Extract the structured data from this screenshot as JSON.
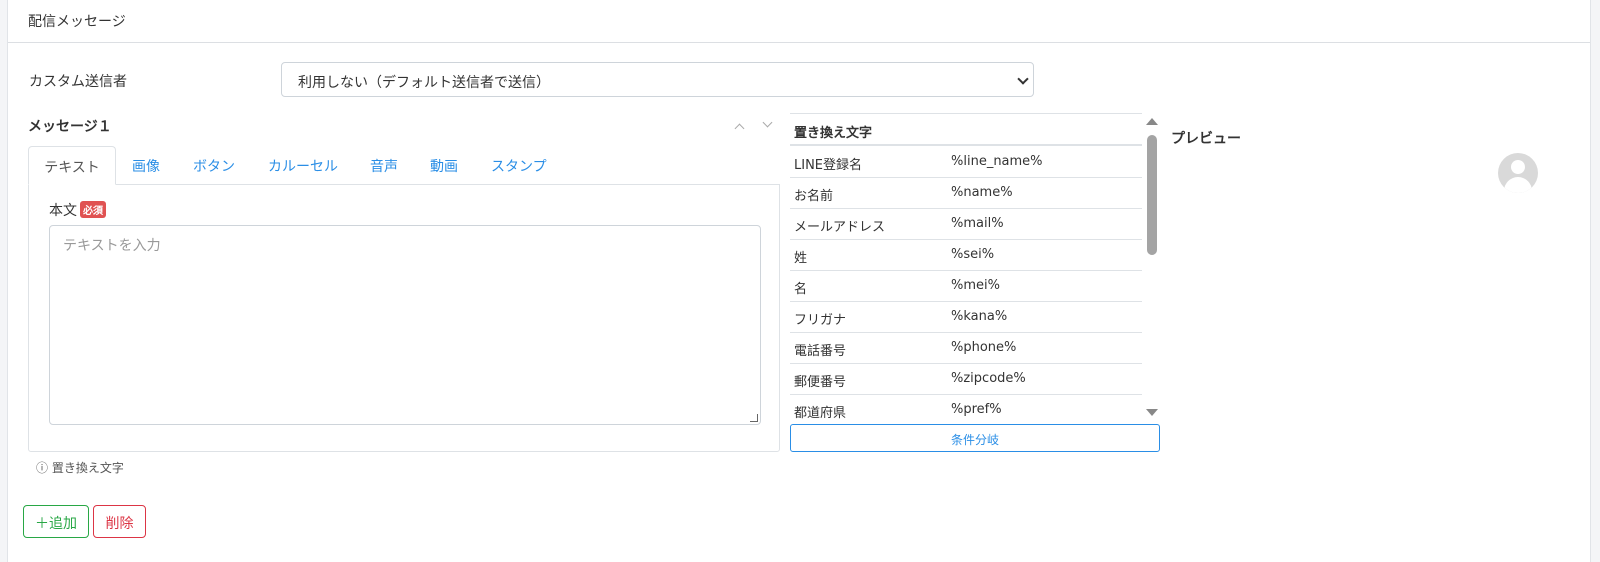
{
  "card": {
    "title": "配信メッセージ"
  },
  "sender": {
    "label": "カスタム送信者",
    "selected": "利用しない（デフォルト送信者で送信）"
  },
  "message": {
    "title": "メッセージ１",
    "tabs": [
      {
        "label": "テキスト",
        "active": true
      },
      {
        "label": "画像"
      },
      {
        "label": "ボタン"
      },
      {
        "label": "カルーセル"
      },
      {
        "label": "音声"
      },
      {
        "label": "動画"
      },
      {
        "label": "スタンプ"
      }
    ],
    "body_label": "本文",
    "required_badge": "必須",
    "textarea_placeholder": "テキストを入力",
    "hint": "ⓘ 置き換え文字"
  },
  "replacements": {
    "header": "置き換え文字",
    "rows": [
      {
        "key": "LINE登録名",
        "value": "%line_name%"
      },
      {
        "key": "お名前",
        "value": "%name%"
      },
      {
        "key": "メールアドレス",
        "value": "%mail%"
      },
      {
        "key": "姓",
        "value": "%sei%"
      },
      {
        "key": "名",
        "value": "%mei%"
      },
      {
        "key": "フリガナ",
        "value": "%kana%"
      },
      {
        "key": "電話番号",
        "value": "%phone%"
      },
      {
        "key": "郵便番号",
        "value": "%zipcode%"
      },
      {
        "key": "都道府県",
        "value": "%pref%"
      }
    ],
    "branch_button": "条件分岐"
  },
  "preview": {
    "label": "プレビュー"
  },
  "actions": {
    "add": "＋追加",
    "delete": "削除"
  },
  "colors": {
    "accent": "#2a8ee6",
    "success": "#28a745",
    "danger": "#dc3545"
  }
}
